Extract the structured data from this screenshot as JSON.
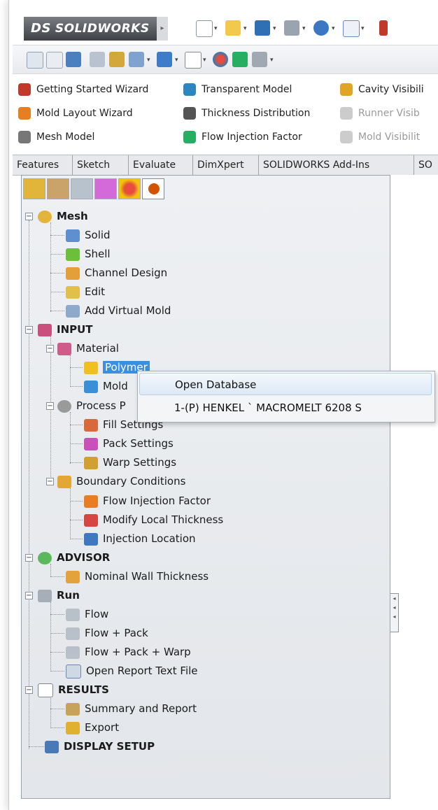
{
  "app": {
    "logo": "SOLIDWORKS",
    "logo_prefix": "DS"
  },
  "commands": [
    {
      "label": "Getting Started Wizard",
      "icon": "wizard-icon",
      "color": "#c0392b",
      "enabled": true
    },
    {
      "label": "Transparent Model",
      "icon": "transparent-model-icon",
      "color": "#2e86c1",
      "enabled": true
    },
    {
      "label": "Cavity Visibili",
      "icon": "cavity-icon",
      "color": "#e0a526",
      "enabled": true
    },
    {
      "label": "Mold Layout Wizard",
      "icon": "mold-layout-icon",
      "color": "#e67e22",
      "enabled": true
    },
    {
      "label": "Thickness Distribution",
      "icon": "thickness-icon",
      "color": "#555555",
      "enabled": true
    },
    {
      "label": "Runner Visib",
      "icon": "runner-icon",
      "color": "#bbbbbb",
      "enabled": false
    },
    {
      "label": "Mesh Model",
      "icon": "mesh-model-icon",
      "color": "#666666",
      "enabled": true
    },
    {
      "label": "Flow Injection Factor",
      "icon": "flow-injection-icon",
      "color": "#27ae60",
      "enabled": true
    },
    {
      "label": "Mold Visibilit",
      "icon": "mold-visibility-icon",
      "color": "#bbbbbb",
      "enabled": false
    }
  ],
  "tabs": [
    "Features",
    "Sketch",
    "Evaluate",
    "DimXpert",
    "SOLIDWORKS Add-Ins",
    "SO"
  ],
  "tree": [
    {
      "label": "Mesh",
      "bold": true
    },
    {
      "label": "Solid"
    },
    {
      "label": "Shell"
    },
    {
      "label": "Channel Design"
    },
    {
      "label": "Edit"
    },
    {
      "label": "Add Virtual Mold"
    },
    {
      "label": "INPUT",
      "bold": true
    },
    {
      "label": "Material"
    },
    {
      "label": "Polymer",
      "selected": true
    },
    {
      "label": "Mold"
    },
    {
      "label": "Process P"
    },
    {
      "label": "Fill Settings"
    },
    {
      "label": "Pack Settings"
    },
    {
      "label": "Warp Settings"
    },
    {
      "label": "Boundary Conditions"
    },
    {
      "label": "Flow Injection Factor"
    },
    {
      "label": "Modify Local Thickness"
    },
    {
      "label": "Injection Location"
    },
    {
      "label": "ADVISOR",
      "bold": true
    },
    {
      "label": "Nominal Wall Thickness"
    },
    {
      "label": "Run",
      "bold": true
    },
    {
      "label": "Flow"
    },
    {
      "label": "Flow + Pack"
    },
    {
      "label": "Flow + Pack + Warp"
    },
    {
      "label": "Open Report Text File"
    },
    {
      "label": "RESULTS",
      "bold": true
    },
    {
      "label": "Summary and Report"
    },
    {
      "label": "Export"
    },
    {
      "label": "DISPLAY SETUP",
      "bold": true
    }
  ],
  "context_menu": {
    "items": [
      "Open Database",
      "1-(P)  HENKEL ` MACROMELT 6208 S"
    ]
  },
  "glyphs": {
    "expanded": "−",
    "caret": "▾",
    "collapse_arrows": "◂"
  }
}
